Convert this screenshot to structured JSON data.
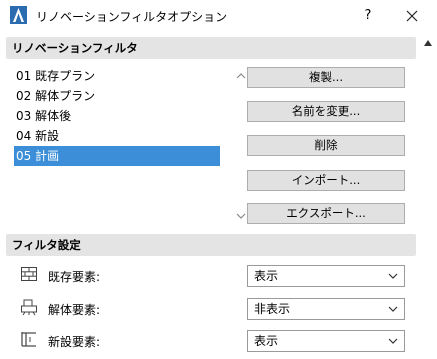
{
  "window": {
    "title": "リノベーションフィルタオプション",
    "help_label": "?"
  },
  "renovation_section": {
    "header": "リノベーションフィルタ",
    "items": [
      {
        "label": "01 既存プラン",
        "selected": false
      },
      {
        "label": "02 解体プラン",
        "selected": false
      },
      {
        "label": "03 解体後",
        "selected": false
      },
      {
        "label": "04 新設",
        "selected": false
      },
      {
        "label": "05 計画",
        "selected": true
      }
    ],
    "buttons": {
      "duplicate": "複製...",
      "rename": "名前を変更...",
      "delete": "削除",
      "import": "インポート...",
      "export": "エクスポート..."
    }
  },
  "filter_settings": {
    "header": "フィルタ設定",
    "rows": [
      {
        "label": "既存要素:",
        "value": "表示",
        "icon": "existing-wall-icon"
      },
      {
        "label": "解体要素:",
        "value": "非表示",
        "icon": "demolish-icon"
      },
      {
        "label": "新設要素:",
        "value": "表示",
        "icon": "new-element-icon"
      }
    ]
  },
  "colors": {
    "selection": "#3b8ed7",
    "section_bg": "#e4e4e4",
    "button_bg": "#e1e1e1",
    "app_icon": "#2b6cb0"
  }
}
